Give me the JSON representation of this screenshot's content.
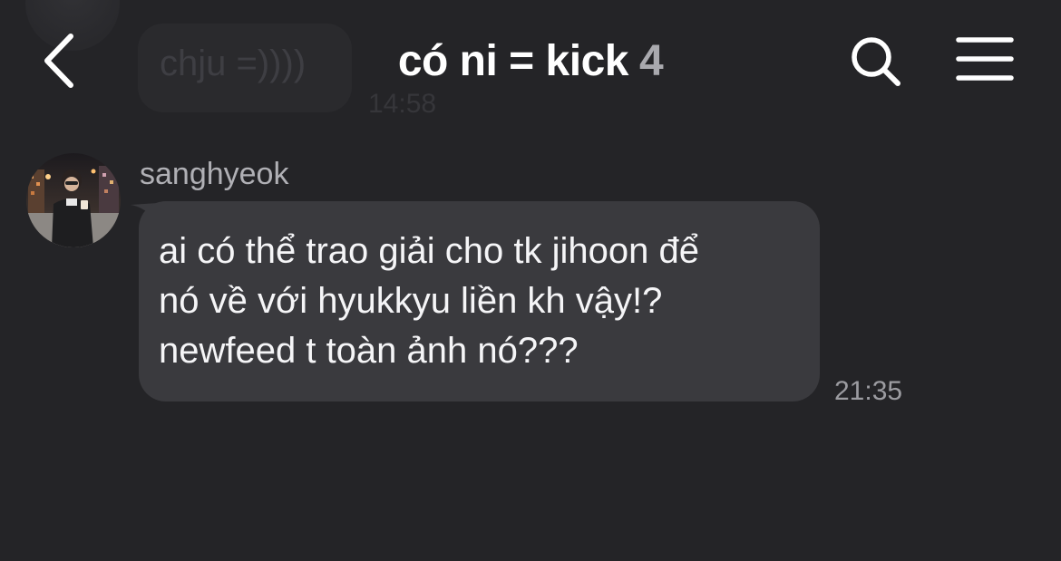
{
  "previous_message": {
    "text": "chju =))))",
    "time": "14:58"
  },
  "header": {
    "title": "có ni = kick",
    "member_count": "4",
    "back_icon": "chevron-left-icon",
    "search_icon": "search-icon",
    "menu_icon": "hamburger-menu-icon"
  },
  "message": {
    "sender": "sanghyeok",
    "lines": [
      "ai có thể trao giải cho tk jihoon để",
      "nó về với hyukkyu liền kh vậy!?",
      "newfeed t toàn ảnh nó???"
    ],
    "time": "21:35"
  },
  "colors": {
    "background": "#242427",
    "bubble": "#3a3a3e",
    "text": "#ffffff",
    "muted": "#9c9ca1"
  }
}
